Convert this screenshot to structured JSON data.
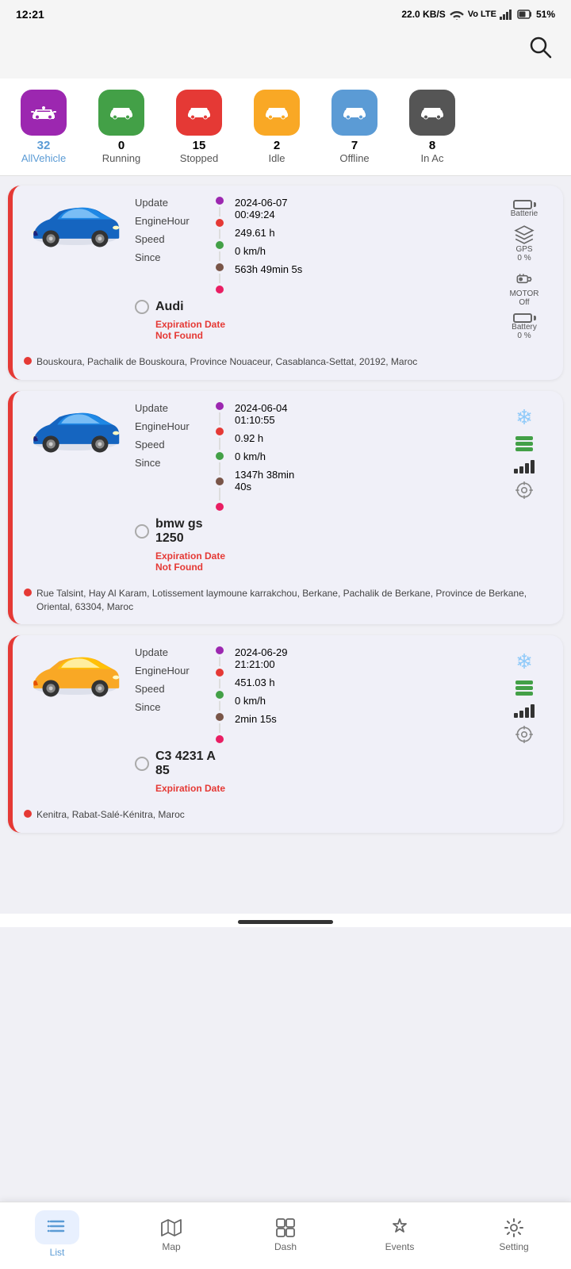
{
  "statusBar": {
    "time": "12:21",
    "network": "22.0 KB/S",
    "battery": "51%"
  },
  "tabs": [
    {
      "id": "all",
      "count": "32",
      "label": "AllVehicle",
      "color": "#9c27b0",
      "active": true
    },
    {
      "id": "running",
      "count": "0",
      "label": "Running",
      "color": "#43a047",
      "active": false
    },
    {
      "id": "stopped",
      "count": "15",
      "label": "Stopped",
      "color": "#e53935",
      "active": false
    },
    {
      "id": "idle",
      "count": "2",
      "label": "Idle",
      "color": "#f9a825",
      "active": false
    },
    {
      "id": "offline",
      "count": "7",
      "label": "Offline",
      "color": "#5b9bd5",
      "active": false
    },
    {
      "id": "inac",
      "count": "8",
      "label": "In Ac",
      "color": "#555",
      "active": false
    }
  ],
  "vehicles": [
    {
      "name": "Audi",
      "color": "blue",
      "expiry": "Expiration Date\nNot Found",
      "update": "2024-06-07\n00:49:24",
      "engineHour": "249.61 h",
      "speed": "0 km/h",
      "since": "563h 49min 5s",
      "batterie": "Batterie",
      "gps": "GPS\n0 %",
      "motor": "MOTOR\nOff",
      "battery": "Battery\n0 %",
      "address": "Bouskoura, Pachalik de Bouskoura, Province Nouaceur, Casablanca-Settat, 20192, Maroc",
      "batteryPct": 0,
      "gpsPct": 0
    },
    {
      "name": "bmw gs\n1250",
      "color": "blue",
      "expiry": "Expiration Date\nNot Found",
      "update": "2024-06-04\n01:10:55",
      "engineHour": "0.92 h",
      "speed": "0 km/h",
      "since": "1347h 38min\n40s",
      "address": "Rue Talsint, Hay Al Karam, Lotissement laymoune karrakchou, Berkane, Pachalik de Berkane, Province de Berkane, Oriental, 63304, Maroc",
      "hasSnowflake": true,
      "hasGreenBattery": true,
      "hasSignal": true,
      "hasTarget": true
    },
    {
      "name": "C3 4231 A\n85",
      "color": "yellow",
      "expiry": "Expiration Date",
      "update": "2024-06-29\n21:21:00",
      "engineHour": "451.03 h",
      "speed": "0 km/h",
      "since": "2min 15s",
      "address": "Kenitra, Rabat-Salé-Kénitra, Maroc",
      "hasSnowflake": true,
      "hasGreenBattery": true,
      "hasSignal": true,
      "hasTarget": true
    }
  ],
  "bottomNav": [
    {
      "id": "list",
      "label": "List",
      "active": true
    },
    {
      "id": "map",
      "label": "Map",
      "active": false
    },
    {
      "id": "dash",
      "label": "Dash",
      "active": false
    },
    {
      "id": "events",
      "label": "Events",
      "active": false
    },
    {
      "id": "setting",
      "label": "Setting",
      "active": false
    }
  ]
}
